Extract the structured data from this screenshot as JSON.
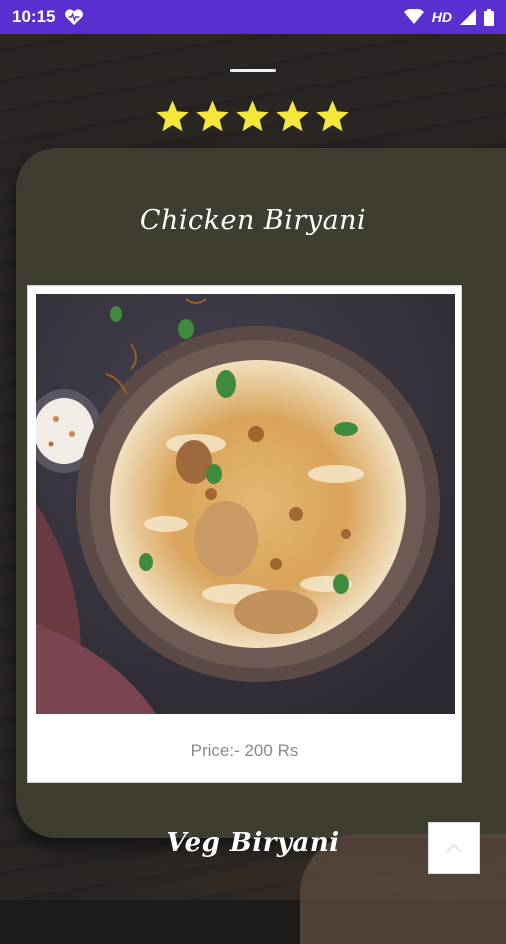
{
  "status_bar": {
    "time": "10:15",
    "network": "HD"
  },
  "rating": {
    "stars": 5,
    "max": 5,
    "color": "#f5e63a"
  },
  "dish": {
    "name": "Chicken Biryani",
    "price": "Price:- 200 Rs"
  },
  "next_dish": {
    "name": "Veg Biryani"
  },
  "colors": {
    "status_bar": "#5a2fd0",
    "card": "#3f3d30"
  }
}
